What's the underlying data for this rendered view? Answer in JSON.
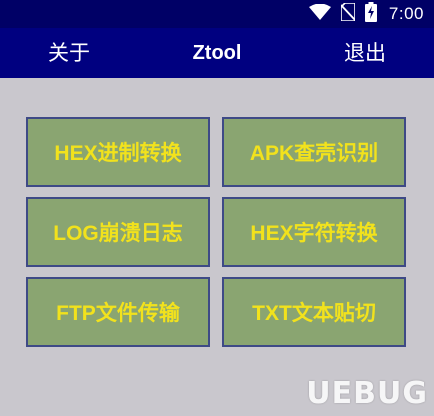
{
  "status_bar": {
    "time": "7:00",
    "icons": [
      "wifi-icon",
      "no-sim-icon",
      "battery-charging-icon"
    ]
  },
  "app_bar": {
    "left_label": "关于",
    "title": "Ztool",
    "right_label": "退出"
  },
  "tiles": [
    {
      "label": "HEX进制转换"
    },
    {
      "label": "APK查壳识别"
    },
    {
      "label": "LOG崩溃日志"
    },
    {
      "label": "HEX字符转换"
    },
    {
      "label": "FTP文件传输"
    },
    {
      "label": "TXT文本贴切"
    }
  ],
  "watermark": {
    "text": "UEBUG"
  },
  "colors": {
    "status_bar_bg": "#000066",
    "app_bar_bg": "#000080",
    "content_bg": "#c9c7cd",
    "tile_bg": "#8aa571",
    "tile_border": "#3e4a86",
    "tile_text": "#f2e21c"
  }
}
